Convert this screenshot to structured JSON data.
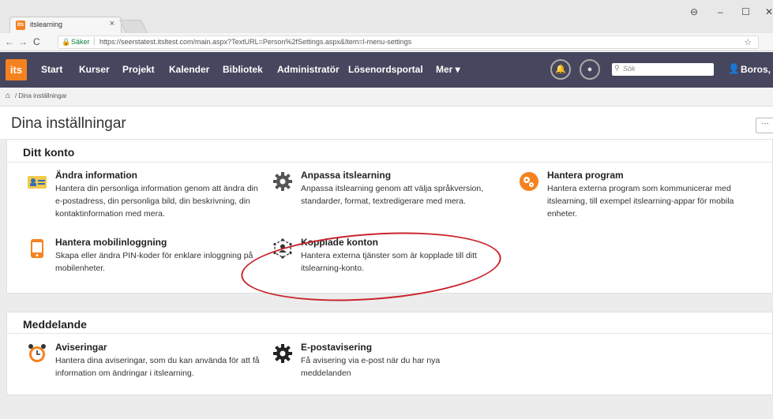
{
  "browser": {
    "tab_title": "itslearning",
    "tab_close": "×",
    "secure_label": "Säker",
    "url": "https://seerstatest.itsltest.com/main.aspx?TextURL=Person%2fSettings.aspx&Item=l-menu-settings"
  },
  "nav": {
    "logo": "its",
    "items": [
      "Start",
      "Kurser",
      "Projekt",
      "Kalender",
      "Bibliotek",
      "Administratör",
      "Lösenordsportal",
      "Mer ▾"
    ],
    "search_placeholder": "Sök",
    "user_name": "Boros, Tomi"
  },
  "breadcrumb": "/ Dina inställningar",
  "page_title": "Dina inställningar",
  "more_button": "···",
  "sections": [
    {
      "title": "Ditt konto",
      "items": [
        {
          "icon": "id-card-icon",
          "title": "Ändra information",
          "desc": "Hantera din personliga information genom att ändra din e-postadress, din personliga bild, din beskrivning, din kontaktinformation med mera."
        },
        {
          "icon": "gear-icon",
          "title": "Anpassa itslearning",
          "desc": "Anpassa itslearning genom att välja språkversion, standarder, format, textredigerare med mera."
        },
        {
          "icon": "gears-icon",
          "title": "Hantera program",
          "desc": "Hantera externa program som kommunicerar med itslearning, till exempel itslearning-appar för mobila enheter."
        },
        {
          "icon": "mobile-icon",
          "title": "Hantera mobilinloggning",
          "desc": "Skapa eller ändra PIN-koder för enklare inloggning på mobilenheter."
        },
        {
          "icon": "connected-accounts-icon",
          "title": "Kopplade konton",
          "desc": "Hantera externa tjänster som är kopplade till ditt itslearning-konto."
        }
      ]
    },
    {
      "title": "Meddelande",
      "items": [
        {
          "icon": "alarm-clock-icon",
          "title": "Aviseringar",
          "desc": "Hantera dina aviseringar, som du kan använda för att få information om ändringar i itslearning."
        },
        {
          "icon": "gear-icon",
          "title": "E-postavisering",
          "desc": "Få avisering via e-post när du har nya meddelanden"
        }
      ]
    }
  ]
}
